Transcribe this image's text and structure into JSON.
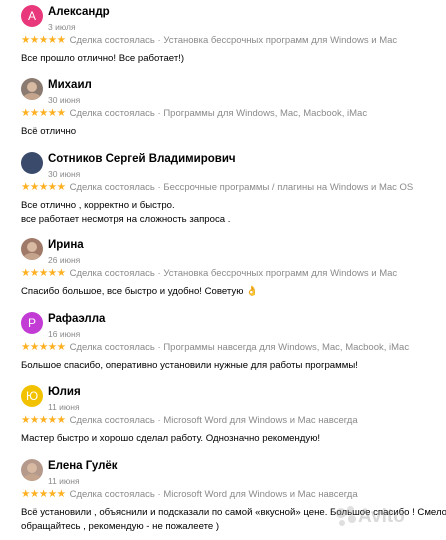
{
  "reviews": [
    {
      "name": "Александр",
      "date": "3 июля",
      "avatar_letter": "А",
      "avatar_color": "#e8377a",
      "stars": "★★★★★",
      "status": "Сделка состоялась",
      "item": "Установка бессрочных программ для Windows и Mac",
      "text": [
        "Все прошло отлично! Все работает!)"
      ]
    },
    {
      "name": "Михаил",
      "date": "30 июня",
      "avatar_letter": "",
      "avatar_color": "#8a7a70",
      "stars": "★★★★★",
      "status": "Сделка состоялась",
      "item": "Программы для Windows, Mac, Macbook, iMac",
      "text": [
        "Всё отлично"
      ]
    },
    {
      "name": "Сотников Сергей Владимирович",
      "date": "30 июня",
      "avatar_letter": "",
      "avatar_color": "#3a4a6a",
      "stars": "★★★★★",
      "status": "Сделка состоялась",
      "item": "Бессрочные программы / плагины на Windows и Mac OS",
      "text": [
        "Все отлично , корректно и быстро.",
        "все работает несмотря на сложность запроса ."
      ]
    },
    {
      "name": "Ирина",
      "date": "26 июня",
      "avatar_letter": "",
      "avatar_color": "#a07a68",
      "stars": "★★★★★",
      "status": "Сделка состоялась",
      "item": "Установка бессрочных программ для Windows и Mac",
      "text": [
        "Спасибо большое, все быстро и удобно! Советую 👌"
      ]
    },
    {
      "name": "Рафаэлла",
      "date": "16 июня",
      "avatar_letter": "Р",
      "avatar_color": "#c23bd4",
      "stars": "★★★★★",
      "status": "Сделка состоялась",
      "item": "Программы навсегда для Windows, Mac, Macbook, iMac",
      "text": [
        "Большое спасибо, оперативно установили нужные для работы программы!"
      ]
    },
    {
      "name": "Юлия",
      "date": "11 июня",
      "avatar_letter": "Ю",
      "avatar_color": "#f2c200",
      "stars": "★★★★★",
      "status": "Сделка состоялась",
      "item": "Microsoft Word для Windows и Mac навсегда",
      "text": [
        "Мастер быстро и хорошо сделал работу. Однозначно рекомендую!"
      ]
    },
    {
      "name": "Елена Гулёк",
      "date": "11 июня",
      "avatar_letter": "",
      "avatar_color": "#b59a8c",
      "stars": "★★★★★",
      "status": "Сделка состоялась",
      "item": "Microsoft Word для Windows и Mac навсегда",
      "text": [
        "Всё установили , объяснили и подсказали по самой «вкусной» цене. Большое спасибо ! Смело",
        "обращайтесь , рекомендую - не пожалеете )"
      ]
    }
  ],
  "watermark": "Avito"
}
